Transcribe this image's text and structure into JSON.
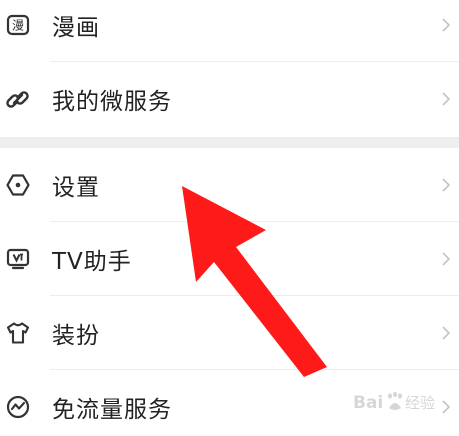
{
  "menu": {
    "items": [
      {
        "key": "comic",
        "label": "漫画",
        "icon": "comic-icon"
      },
      {
        "key": "micro-service",
        "label": "我的微服务",
        "icon": "link-icon"
      },
      {
        "key": "settings",
        "label": "设置",
        "icon": "hexagon-settings-icon"
      },
      {
        "key": "tv-assistant",
        "label": "TV助手",
        "icon": "tv-icon"
      },
      {
        "key": "dress-up",
        "label": "装扮",
        "icon": "tshirt-icon"
      },
      {
        "key": "free-traffic",
        "label": "免流量服务",
        "icon": "pulse-circle-icon"
      }
    ]
  },
  "icon_glyphs": {
    "comic": "漫"
  },
  "colors": {
    "text": "#222222",
    "icon": "#333333",
    "chevron": "#c4c4c4",
    "divider": "#ededed",
    "section_gap": "#eeeeee",
    "annotation_arrow": "#ff1a1a"
  }
}
